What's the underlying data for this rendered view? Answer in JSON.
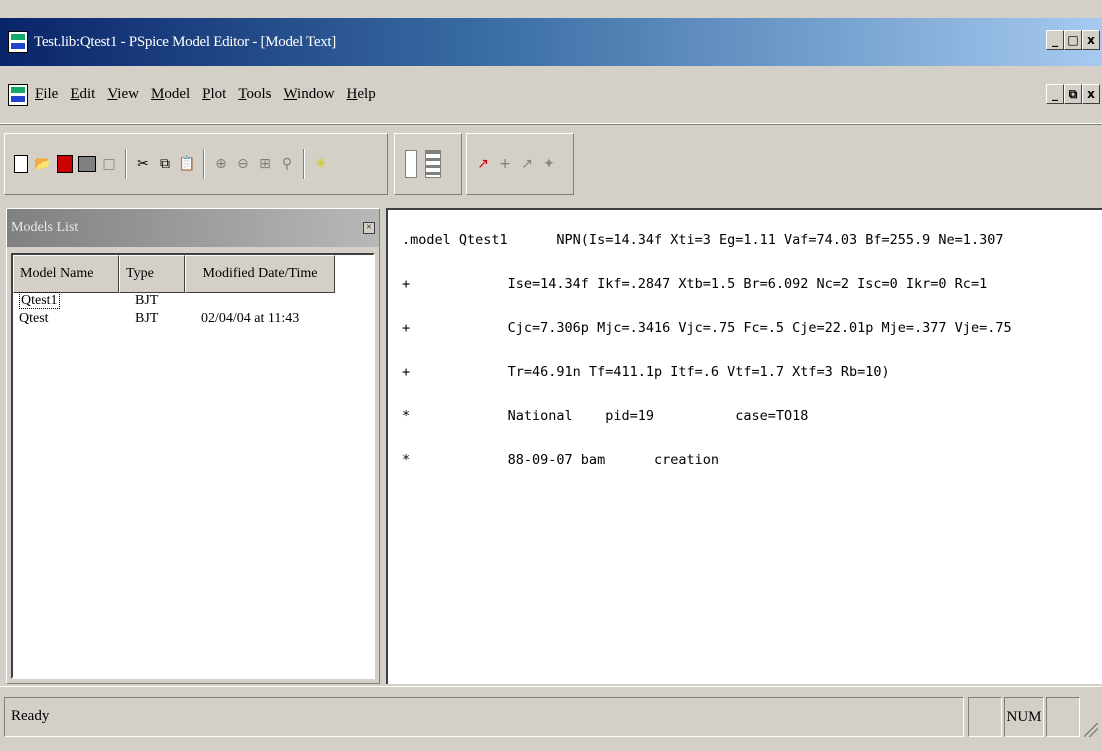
{
  "window": {
    "title": "Test.lib:Qtest1 - PSpice Model Editor - [Model Text]",
    "controls": [
      "_",
      "□",
      "x"
    ],
    "child_controls": [
      "_",
      "⧉",
      "x"
    ]
  },
  "menu": {
    "items": [
      "File",
      "Edit",
      "View",
      "Model",
      "Plot",
      "Tools",
      "Window",
      "Help"
    ]
  },
  "toolbar": {
    "icons": [
      "new-icon",
      "open-icon",
      "save-icon",
      "print-icon",
      "print-preview-icon",
      "cut-icon",
      "copy-icon",
      "paste-icon",
      "zoom-in-icon",
      "zoom-out-icon",
      "zoom-area-icon",
      "zoom-fit-icon",
      "extract-model-icon",
      "view-panel-icon",
      "view-text-icon",
      "add-trace-icon",
      "cursor-icon",
      "trace-icon",
      "fit-icon"
    ]
  },
  "models_list": {
    "title": "Models List",
    "close_label": "×",
    "columns": [
      "Model Name",
      "Type",
      "Modified Date/Time"
    ],
    "rows": [
      {
        "name": "Qtest1",
        "type": "BJT",
        "modified": ""
      },
      {
        "name": "Qtest",
        "type": "BJT",
        "modified": "02/04/04 at 11:43"
      }
    ]
  },
  "editor": {
    "lines": [
      ".model Qtest1      NPN(Is=14.34f Xti=3 Eg=1.11 Vaf=74.03 Bf=255.9 Ne=1.307",
      "+            Ise=14.34f Ikf=.2847 Xtb=1.5 Br=6.092 Nc=2 Isc=0 Ikr=0 Rc=1",
      "+            Cjc=7.306p Mjc=.3416 Vjc=.75 Fc=.5 Cje=22.01p Mje=.377 Vje=.75",
      "+            Tr=46.91n Tf=411.1p Itf=.6 Vtf=1.7 Xtf=3 Rb=10)",
      "*            National    pid=19          case=TO18",
      "*            88-09-07 bam      creation"
    ]
  },
  "status": {
    "text": "Ready",
    "num": "NUM"
  }
}
